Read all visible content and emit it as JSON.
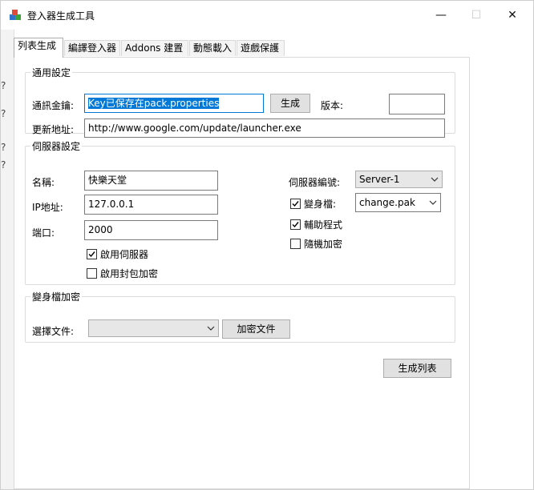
{
  "window": {
    "title": "登入器生成工具",
    "minimize_symbol": "—",
    "maximize_symbol": "☐",
    "close_symbol": "✕"
  },
  "tabs": [
    "列表生成",
    "編譯登入器",
    "Addons 建置",
    "動態載入",
    "遊戲保護"
  ],
  "general": {
    "legend": "通用設定",
    "key_label": "通訊金鑰:",
    "key_value": "Key已保存在pack.properties",
    "generate_btn": "生成",
    "version_label": "版本:",
    "version_value": "",
    "update_label": "更新地址:",
    "update_value": "http://www.google.com/update/launcher.exe"
  },
  "server": {
    "legend": "伺服器設定",
    "name_label": "名稱:",
    "name_value": "快樂天堂",
    "ip_label": "IP地址:",
    "ip_value": "127.0.0.1",
    "port_label": "端口:",
    "port_value": "2000",
    "enable_server": {
      "label": "啟用伺服器",
      "checked": true
    },
    "enable_encrypt": {
      "label": "啟用封包加密",
      "checked": false
    },
    "number_label": "伺服器編號:",
    "number_value": "Server-1",
    "morph": {
      "label": "變身檔:",
      "checked": true
    },
    "morph_file": "change.pak",
    "helper": {
      "label": "輔助程式",
      "checked": true
    },
    "random_encrypt": {
      "label": "隨機加密",
      "checked": false
    }
  },
  "morph_encrypt": {
    "legend": "變身檔加密",
    "file_label": "選擇文件:",
    "file_value": "",
    "encrypt_btn": "加密文件"
  },
  "generate_list_btn": "生成列表",
  "background_window": {
    "glyphs": [
      "?",
      "?",
      "?",
      "?"
    ]
  }
}
